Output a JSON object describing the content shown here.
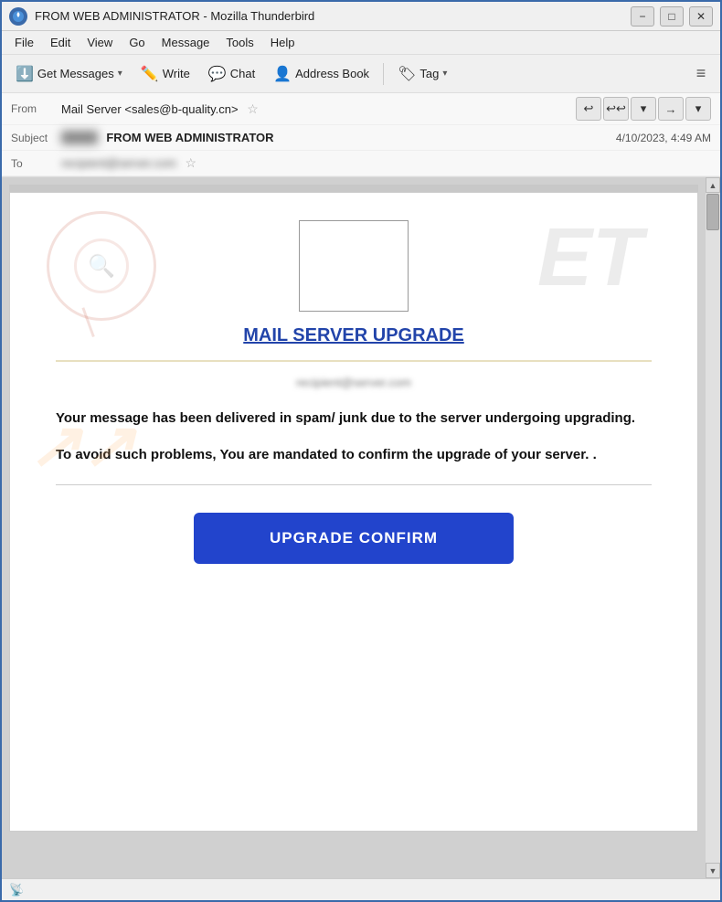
{
  "window": {
    "title": "FROM WEB ADMINISTRATOR - Mozilla Thunderbird",
    "icon": "thunderbird",
    "controls": {
      "minimize": "−",
      "maximize": "□",
      "close": "✕"
    }
  },
  "menubar": {
    "items": [
      "File",
      "Edit",
      "View",
      "Go",
      "Message",
      "Tools",
      "Help"
    ]
  },
  "toolbar": {
    "get_messages_label": "Get Messages",
    "write_label": "Write",
    "chat_label": "Chat",
    "address_book_label": "Address Book",
    "tag_label": "Tag",
    "dropdown_arrow": "▾",
    "menu_icon": "≡"
  },
  "email_header": {
    "from_label": "From",
    "from_value": "Mail Server <sales@b-quality.cn> ☆",
    "from_name": "Mail Server <sales@b-quality.cn>",
    "subject_label": "Subject",
    "subject_prefix_blur": "████████",
    "subject_value": "FROM WEB ADMINISTRATOR",
    "timestamp": "4/10/2023, 4:49 AM",
    "to_label": "To",
    "to_value_blur": "████████████",
    "nav_buttons": [
      "↩",
      "↩↩",
      "▾",
      "→",
      "▾"
    ]
  },
  "email_body": {
    "title": "MAIL SERVER UPGRADE",
    "subtitle_blur": "recipient@server.com",
    "para1": "Your message has been delivered in spam/ junk due to the server undergoing upgrading.",
    "para2": "To avoid such problems, You are mandated to confirm the upgrade of your server.  .",
    "cta_label": "UPGRADE CONFIRM",
    "watermark_text": "ET"
  },
  "status_bar": {
    "icon": "📡"
  }
}
